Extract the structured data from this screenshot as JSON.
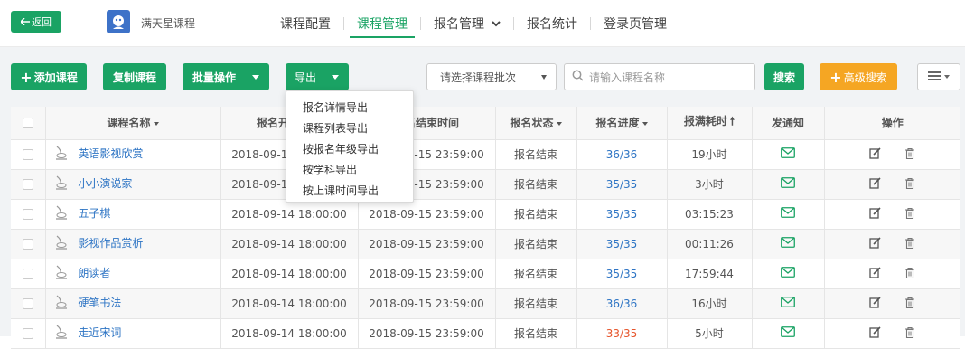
{
  "header": {
    "back_label": "返回",
    "brand": "满天星课程",
    "nav": [
      {
        "label": "课程配置",
        "active": false
      },
      {
        "label": "课程管理",
        "active": true
      },
      {
        "label": "报名管理",
        "active": false,
        "has_dropdown": true
      },
      {
        "label": "报名统计",
        "active": false
      },
      {
        "label": "登录页管理",
        "active": false
      }
    ]
  },
  "toolbar": {
    "add_label": "添加课程",
    "copy_label": "复制课程",
    "batch_label": "批量操作",
    "export_label": "导出",
    "batch_select_placeholder": "请选择课程批次",
    "search_placeholder": "请输入课程名称",
    "search_label": "搜索",
    "advanced_label": "高级搜索"
  },
  "export_menu": [
    "报名详情导出",
    "课程列表导出",
    "按报名年级导出",
    "按学科导出",
    "按上课时间导出"
  ],
  "table": {
    "headers": {
      "name": "课程名称",
      "start": "报名开始时间",
      "end": "报名结束时间",
      "status": "报名状态",
      "progress": "报名进度",
      "duration": "报满耗时",
      "notify": "发通知",
      "actions": "操作"
    },
    "rows": [
      {
        "name": "英语影视欣赏",
        "start": "2018-09-14 18:00:00",
        "end": "2018-09-15 23:59:00",
        "status": "报名结束",
        "progress": "36/36",
        "duration": "19小时"
      },
      {
        "name": "小小演说家",
        "start": "2018-09-14 18:00:00",
        "end": "2018-09-15 23:59:00",
        "status": "报名结束",
        "progress": "35/35",
        "duration": "3小时"
      },
      {
        "name": "五子棋",
        "start": "2018-09-14 18:00:00",
        "end": "2018-09-15 23:59:00",
        "status": "报名结束",
        "progress": "35/35",
        "duration": "03:15:23"
      },
      {
        "name": "影视作品赏析",
        "start": "2018-09-14 18:00:00",
        "end": "2018-09-15 23:59:00",
        "status": "报名结束",
        "progress": "35/35",
        "duration": "00:11:26"
      },
      {
        "name": "朗读者",
        "start": "2018-09-14 18:00:00",
        "end": "2018-09-15 23:59:00",
        "status": "报名结束",
        "progress": "35/35",
        "duration": "17:59:44"
      },
      {
        "name": "硬笔书法",
        "start": "2018-09-14 18:00:00",
        "end": "2018-09-15 23:59:00",
        "status": "报名结束",
        "progress": "36/36",
        "duration": "16小时"
      },
      {
        "name": "走近宋词",
        "start": "2018-09-14 18:00:00",
        "end": "2018-09-15 23:59:00",
        "status": "报名结束",
        "progress": "33/35",
        "duration": "5小时",
        "progress_warn": true
      }
    ]
  },
  "colors": {
    "primary": "#1aa364",
    "link": "#2d74c4",
    "warning": "#f5a623",
    "danger": "#e6552c"
  }
}
